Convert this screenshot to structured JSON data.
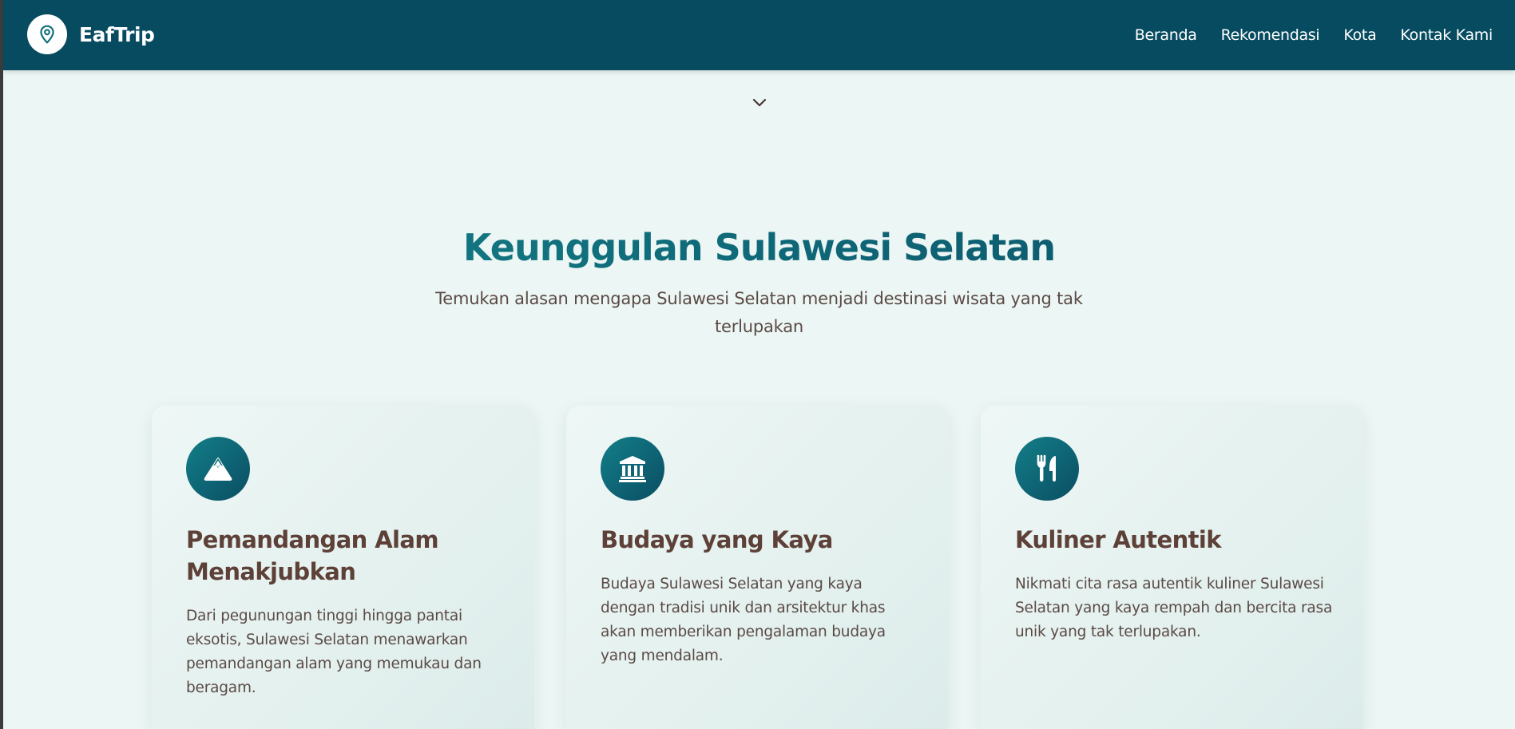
{
  "navbar": {
    "brand_name": "EafTrip",
    "brand_icon": "map-pin-icon",
    "links": [
      {
        "label": "Beranda"
      },
      {
        "label": "Rekomendasi"
      },
      {
        "label": "Kota"
      },
      {
        "label": "Kontak Kami"
      }
    ]
  },
  "scroll_indicator": {
    "icon": "chevron-down-icon"
  },
  "section": {
    "title": "Keunggulan Sulawesi Selatan",
    "subtitle": "Temukan alasan mengapa Sulawesi Selatan menjadi destinasi wisata yang tak terlupakan"
  },
  "cards": [
    {
      "icon": "mountain-icon",
      "title": "Pemandangan Alam Menakjubkan",
      "text": "Dari pegunungan tinggi hingga pantai eksotis, Sulawesi Selatan menawarkan pemandangan alam yang memukau dan beragam."
    },
    {
      "icon": "landmark-icon",
      "title": "Budaya yang Kaya",
      "text": "Budaya Sulawesi Selatan yang kaya dengan tradisi unik dan arsitektur khas akan memberikan pengalaman budaya yang mendalam."
    },
    {
      "icon": "utensils-icon",
      "title": "Kuliner Autentik",
      "text": "Nikmati cita rasa autentik kuliner Sulawesi Selatan yang kaya rempah dan bercita rasa unik yang tak terlupakan."
    }
  ],
  "colors": {
    "navbar_bg": "#074b60",
    "page_bg": "#ecf6f4",
    "title_gradient_start": "#1b8a8c",
    "title_gradient_end": "#0a4d63",
    "card_title": "#5d4037",
    "body_text": "#5a4a45"
  }
}
